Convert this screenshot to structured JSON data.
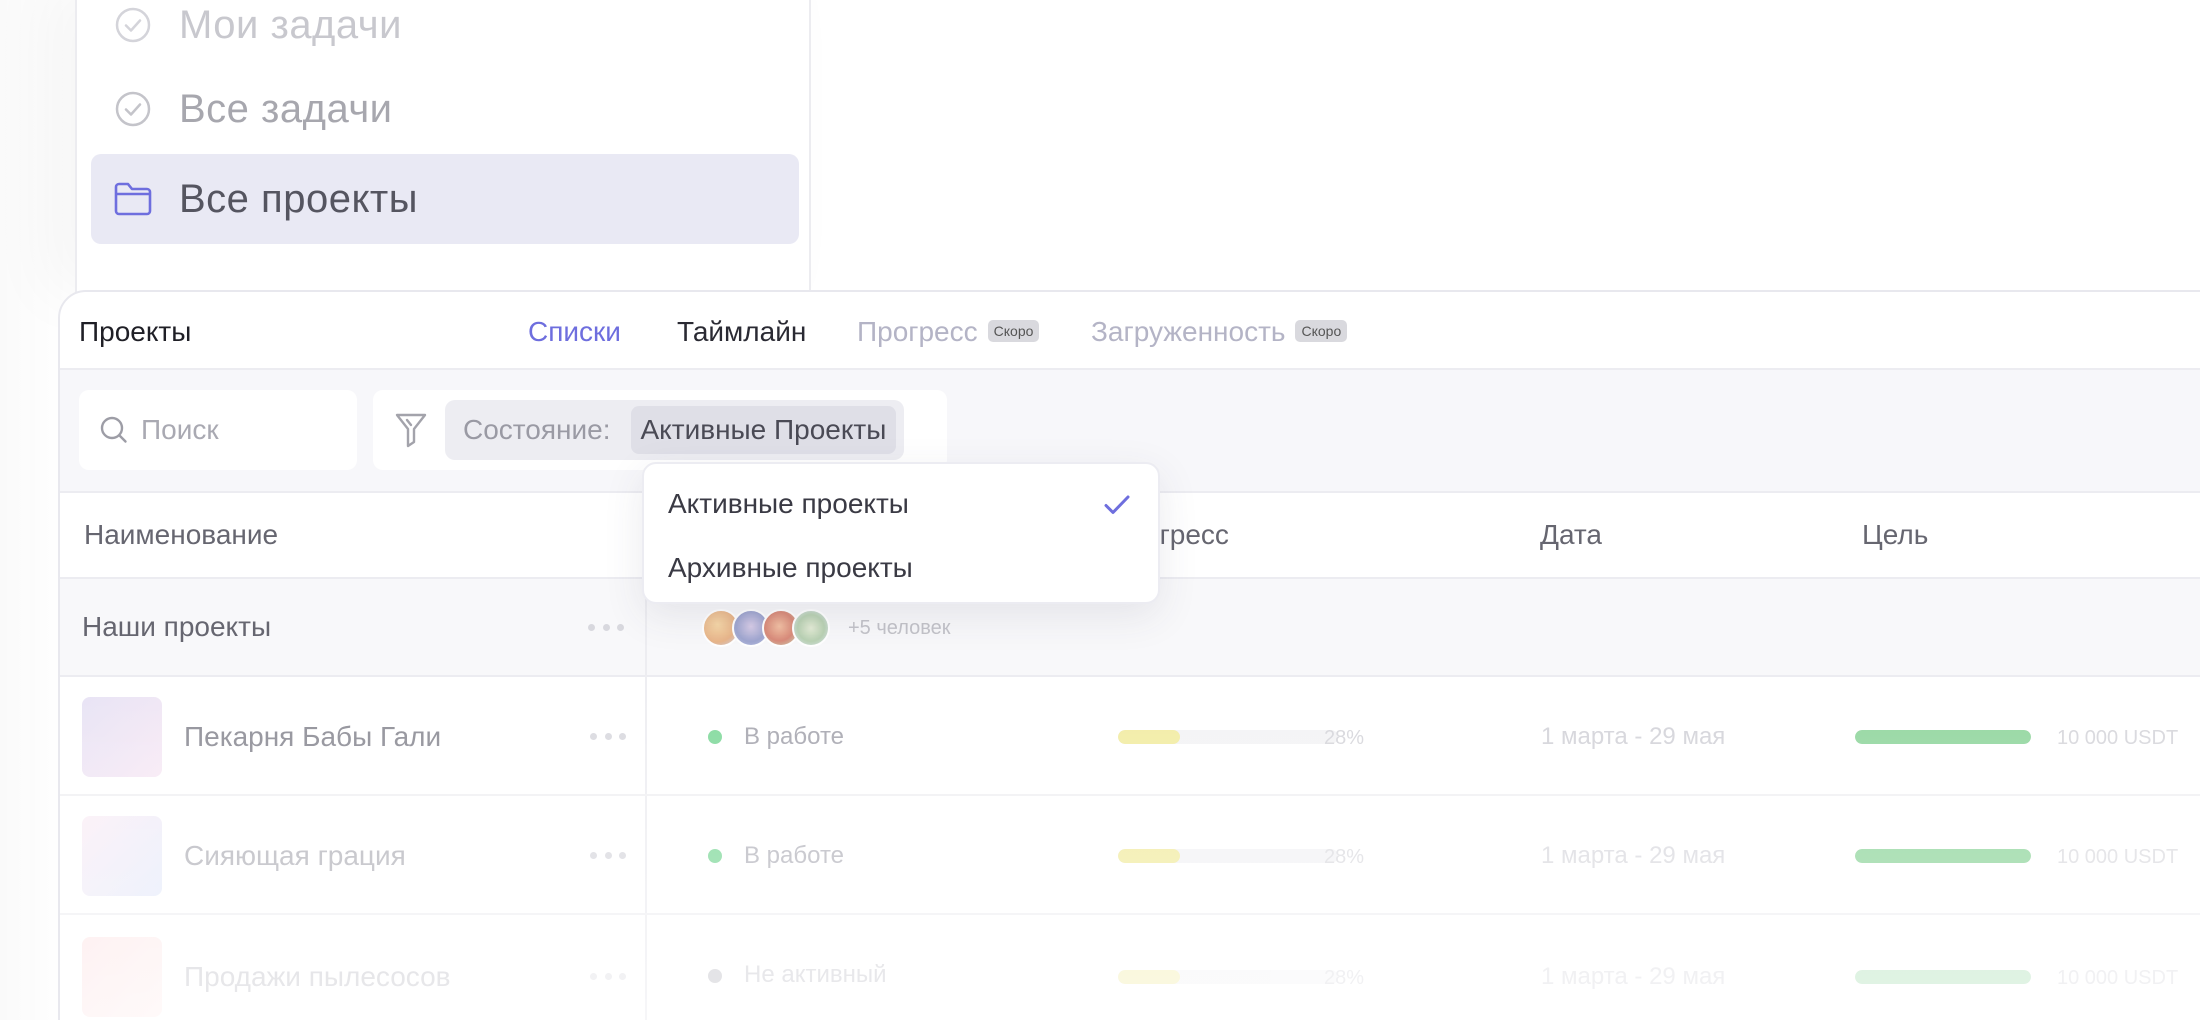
{
  "sidebar": {
    "items": [
      {
        "label": "Мои задачи",
        "icon": "check-circle-icon"
      },
      {
        "label": "Все задачи",
        "icon": "check-circle-icon"
      },
      {
        "label": "Все проекты",
        "icon": "folder-icon",
        "selected": true
      }
    ]
  },
  "header": {
    "title": "Проекты",
    "tabs": [
      {
        "label": "Списки",
        "active": true
      },
      {
        "label": "Таймлайн"
      },
      {
        "label": "Прогресс",
        "badge": "Скоро"
      },
      {
        "label": "Загруженность",
        "badge": "Скоро"
      }
    ]
  },
  "filters": {
    "search_placeholder": "Поиск",
    "state_label": "Состояние:",
    "state_value": "Активные Проекты"
  },
  "dropdown": {
    "options": [
      {
        "label": "Активные проекты",
        "selected": true
      },
      {
        "label": "Архивные проекты"
      }
    ]
  },
  "table": {
    "columns": [
      "Наименование",
      "огресс",
      "Дата",
      "Цель"
    ],
    "group": {
      "name": "Наши проекты",
      "people_extra": "+5 человек"
    },
    "rows": [
      {
        "name": "Пекарня Бабы Гали",
        "status": "В работе",
        "status_color": "#7fd89a",
        "progress": 0.28,
        "progress_label": "28%",
        "date": "1 марта - 29 мая",
        "goal_fill": 1.0,
        "goal": "10 000 USDT"
      },
      {
        "name": "Сияющая грация",
        "status": "В работе",
        "status_color": "#7fd89a",
        "progress": 0.28,
        "progress_label": "28%",
        "date": "1 марта - 29 мая",
        "goal_fill": 1.0,
        "goal": "10 000 USDT"
      },
      {
        "name": "Продажи пылесосов",
        "status": "Не активный",
        "status_color": "#cfcfd4",
        "progress": 0.28,
        "progress_label": "28%",
        "date": "1 марта - 29 мая",
        "goal_fill": 1.0,
        "goal": "10 000 USDT"
      }
    ]
  },
  "colors": {
    "accent": "#6e6ede",
    "selected_bg": "#e9e9f4",
    "progress_yellow": "#f1eba0",
    "goal_green": "#8fd59c"
  }
}
